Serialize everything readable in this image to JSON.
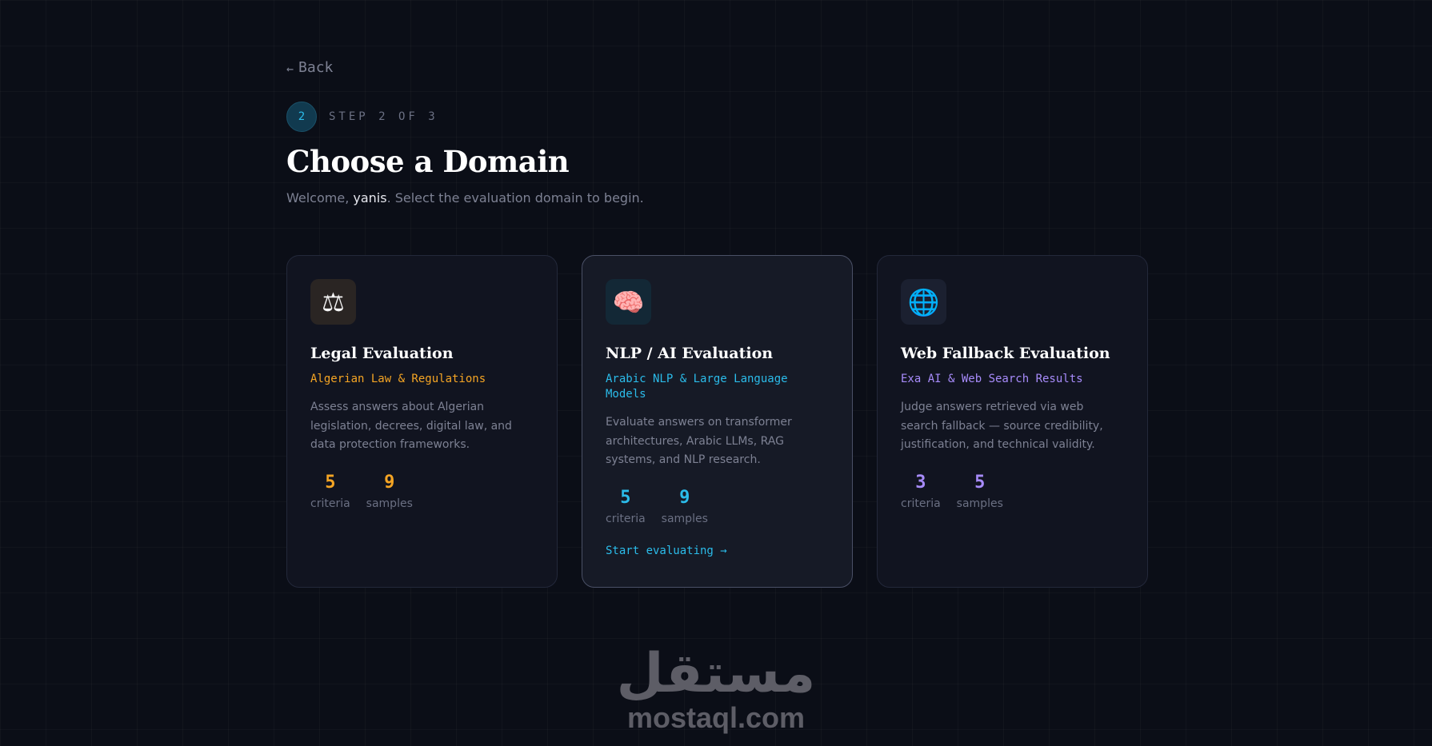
{
  "back": {
    "arrow": "←",
    "label": "Back"
  },
  "step": {
    "number": "2",
    "label": "STEP 2 OF 3"
  },
  "title": "Choose a Domain",
  "subtitle": {
    "prefix": "Welcome, ",
    "user": "yanis",
    "suffix": ". Select the evaluation domain to begin."
  },
  "cards": [
    {
      "icon": "⚖",
      "icon_name": "scales-icon",
      "title": "Legal Evaluation",
      "subtitle": "Algerian Law & Regulations",
      "accent": "#f5a524",
      "description": "Assess answers about Algerian legislation, decrees, digital law, and data protection frameworks.",
      "stats": [
        {
          "value": "5",
          "label": "criteria"
        },
        {
          "value": "9",
          "label": "samples"
        }
      ]
    },
    {
      "icon": "🧠",
      "icon_name": "brain-icon",
      "title": "NLP / AI Evaluation",
      "subtitle": "Arabic NLP & Large Language Models",
      "accent": "#2bbcea",
      "description": "Evaluate answers on transformer architectures, Arabic LLMs, RAG systems, and NLP research.",
      "stats": [
        {
          "value": "5",
          "label": "criteria"
        },
        {
          "value": "9",
          "label": "samples"
        }
      ],
      "cta": "Start evaluating →"
    },
    {
      "icon": "🌐",
      "icon_name": "globe-icon",
      "title": "Web Fallback Evaluation",
      "subtitle": "Exa AI & Web Search Results",
      "accent": "#a78bfa",
      "description": "Judge answers retrieved via web search fallback — source credibility, justification, and technical validity.",
      "stats": [
        {
          "value": "3",
          "label": "criteria"
        },
        {
          "value": "5",
          "label": "samples"
        }
      ]
    }
  ],
  "watermark": {
    "arabic": "مستقل",
    "latin": "mostaql.com"
  }
}
